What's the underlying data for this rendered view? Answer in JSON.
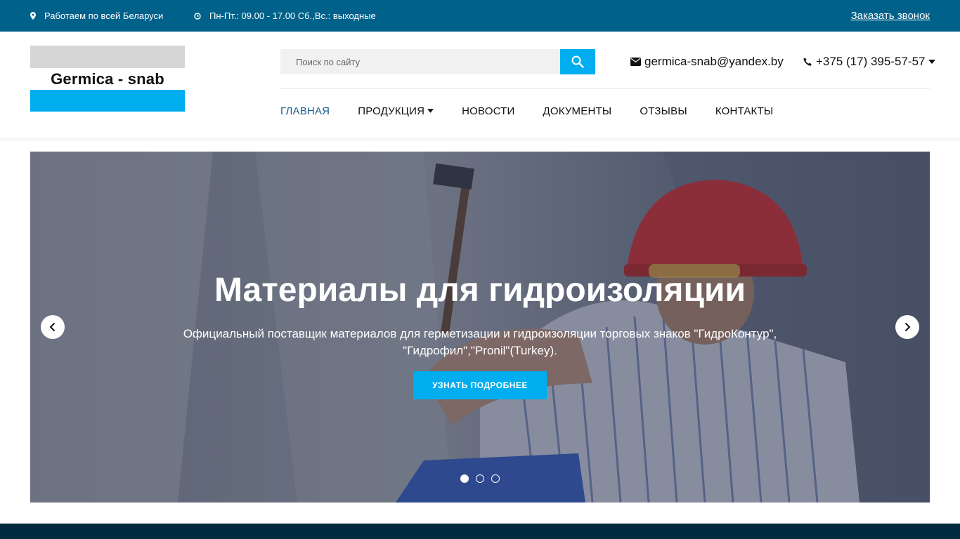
{
  "topbar": {
    "location": "Работаем по всей Беларуси",
    "hours": "Пн-Пт.: 09.00 - 17.00 Сб.,Вс.: выходные",
    "callback": "Заказать звонок"
  },
  "header": {
    "logo_text": "Germica - snab",
    "search_placeholder": "Поиск по сайту",
    "email": "germica-snab@yandex.by",
    "phone": "+375 (17) 395-57-57"
  },
  "nav": {
    "items": [
      {
        "label": "ГЛАВНАЯ"
      },
      {
        "label": "ПРОДУКЦИЯ"
      },
      {
        "label": "НОВОСТИ"
      },
      {
        "label": "ДОКУМЕНТЫ"
      },
      {
        "label": "ОТЗЫВЫ"
      },
      {
        "label": "КОНТАКТЫ"
      }
    ]
  },
  "slider": {
    "title": "Материалы для гидроизоляции",
    "text": "Официальный поставщик материалов для герметизации и гидроизоляции торговых знаков \"ГидроКонтур\", \"Гидрофил\",\"Pronil\"(Turkey).",
    "button": "УЗНАТЬ ПОДРОБНЕЕ",
    "slide_count": 3,
    "active_slide": 1
  },
  "colors": {
    "topbar": "#00618a",
    "accent": "#00aeef",
    "nav_active": "#1a5c8a",
    "footer": "#002a3d"
  },
  "icons": {
    "location": "map-marker-icon",
    "hours": "clock-icon",
    "search": "search-icon",
    "email": "envelope-icon",
    "phone": "phone-icon",
    "prev": "chevron-left-icon",
    "next": "chevron-right-icon"
  }
}
